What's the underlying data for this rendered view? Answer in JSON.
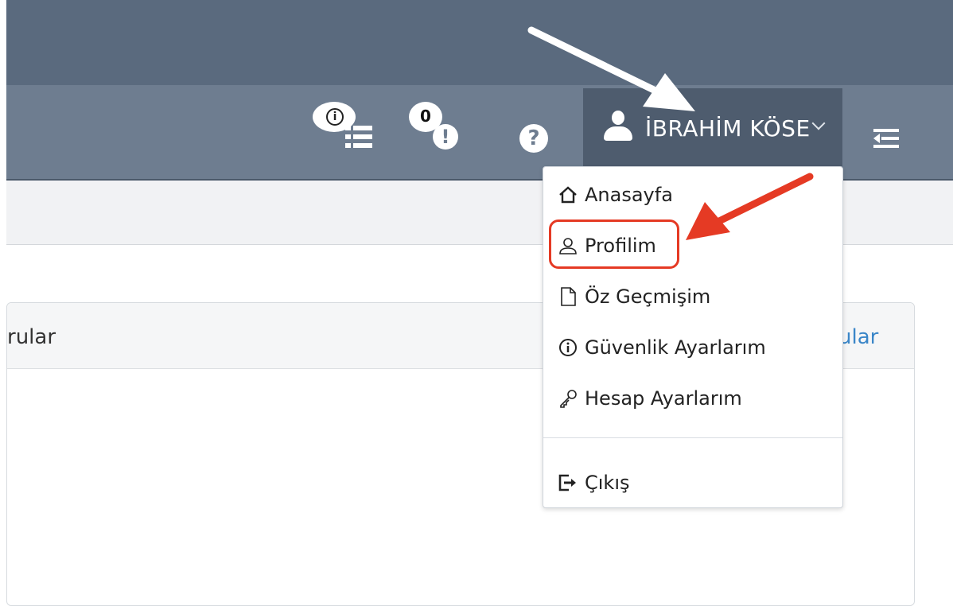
{
  "header": {
    "notification_count": "0",
    "user_name": "İBRAHİM KÖSE"
  },
  "panel": {
    "title_fragment": "rular",
    "link_fragment": "ular"
  },
  "user_menu": {
    "items": [
      {
        "label": "Anasayfa",
        "icon": "home-icon"
      },
      {
        "label": "Profilim",
        "icon": "user-icon"
      },
      {
        "label": "Öz Geçmişim",
        "icon": "document-icon"
      },
      {
        "label": "Güvenlik Ayarlarım",
        "icon": "info-icon"
      },
      {
        "label": "Hesap Ayarlarım",
        "icon": "key-icon"
      }
    ],
    "logout": {
      "label": "Çıkış",
      "icon": "logout-icon"
    }
  },
  "colors": {
    "topbar": "#5a6a7e",
    "navbar": "#6e7d90",
    "user_button": "#4e5c6e",
    "link": "#3a86c8",
    "annotation_red": "#e53a24"
  }
}
